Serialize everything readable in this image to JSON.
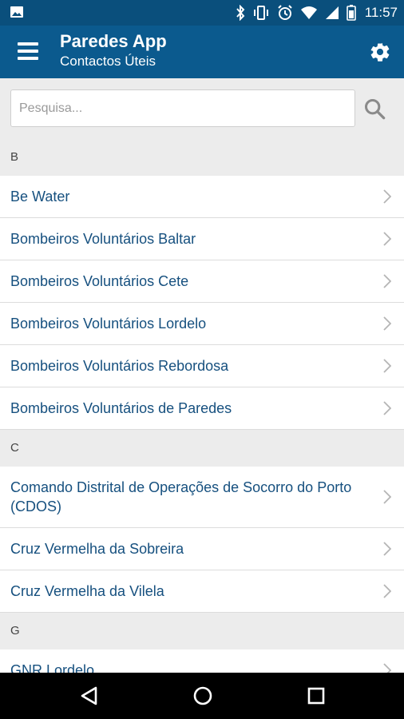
{
  "status_bar": {
    "time": "11:57",
    "icons": [
      "image-icon",
      "bluetooth-icon",
      "vibrate-icon",
      "alarm-icon",
      "wifi-icon",
      "signal-icon",
      "battery-icon"
    ]
  },
  "app_bar": {
    "title": "Paredes App",
    "subtitle": "Contactos Úteis",
    "icons": [
      "menu-icon",
      "gear-icon"
    ]
  },
  "search": {
    "placeholder": "Pesquisa...",
    "value": ""
  },
  "sections": [
    {
      "letter": "B",
      "items": [
        "Be Water",
        "Bombeiros Voluntários Baltar",
        "Bombeiros Voluntários Cete",
        "Bombeiros Voluntários Lordelo",
        "Bombeiros Voluntários Rebordosa",
        "Bombeiros Voluntários de Paredes"
      ]
    },
    {
      "letter": "C",
      "items": [
        "Comando Distrital de Operações de Socorro do Porto (CDOS)",
        "Cruz Vermelha da Sobreira",
        "Cruz Vermelha da Vilela"
      ]
    },
    {
      "letter": "G",
      "items": [
        "GNR Lordelo"
      ]
    }
  ],
  "nav_bar": {
    "icons": [
      "back-icon",
      "home-icon",
      "recents-icon"
    ]
  },
  "colors": {
    "status_bar": "#0a4f7c",
    "app_bar": "#0b5a8e",
    "item_text": "#16507f",
    "background": "#ececec"
  }
}
